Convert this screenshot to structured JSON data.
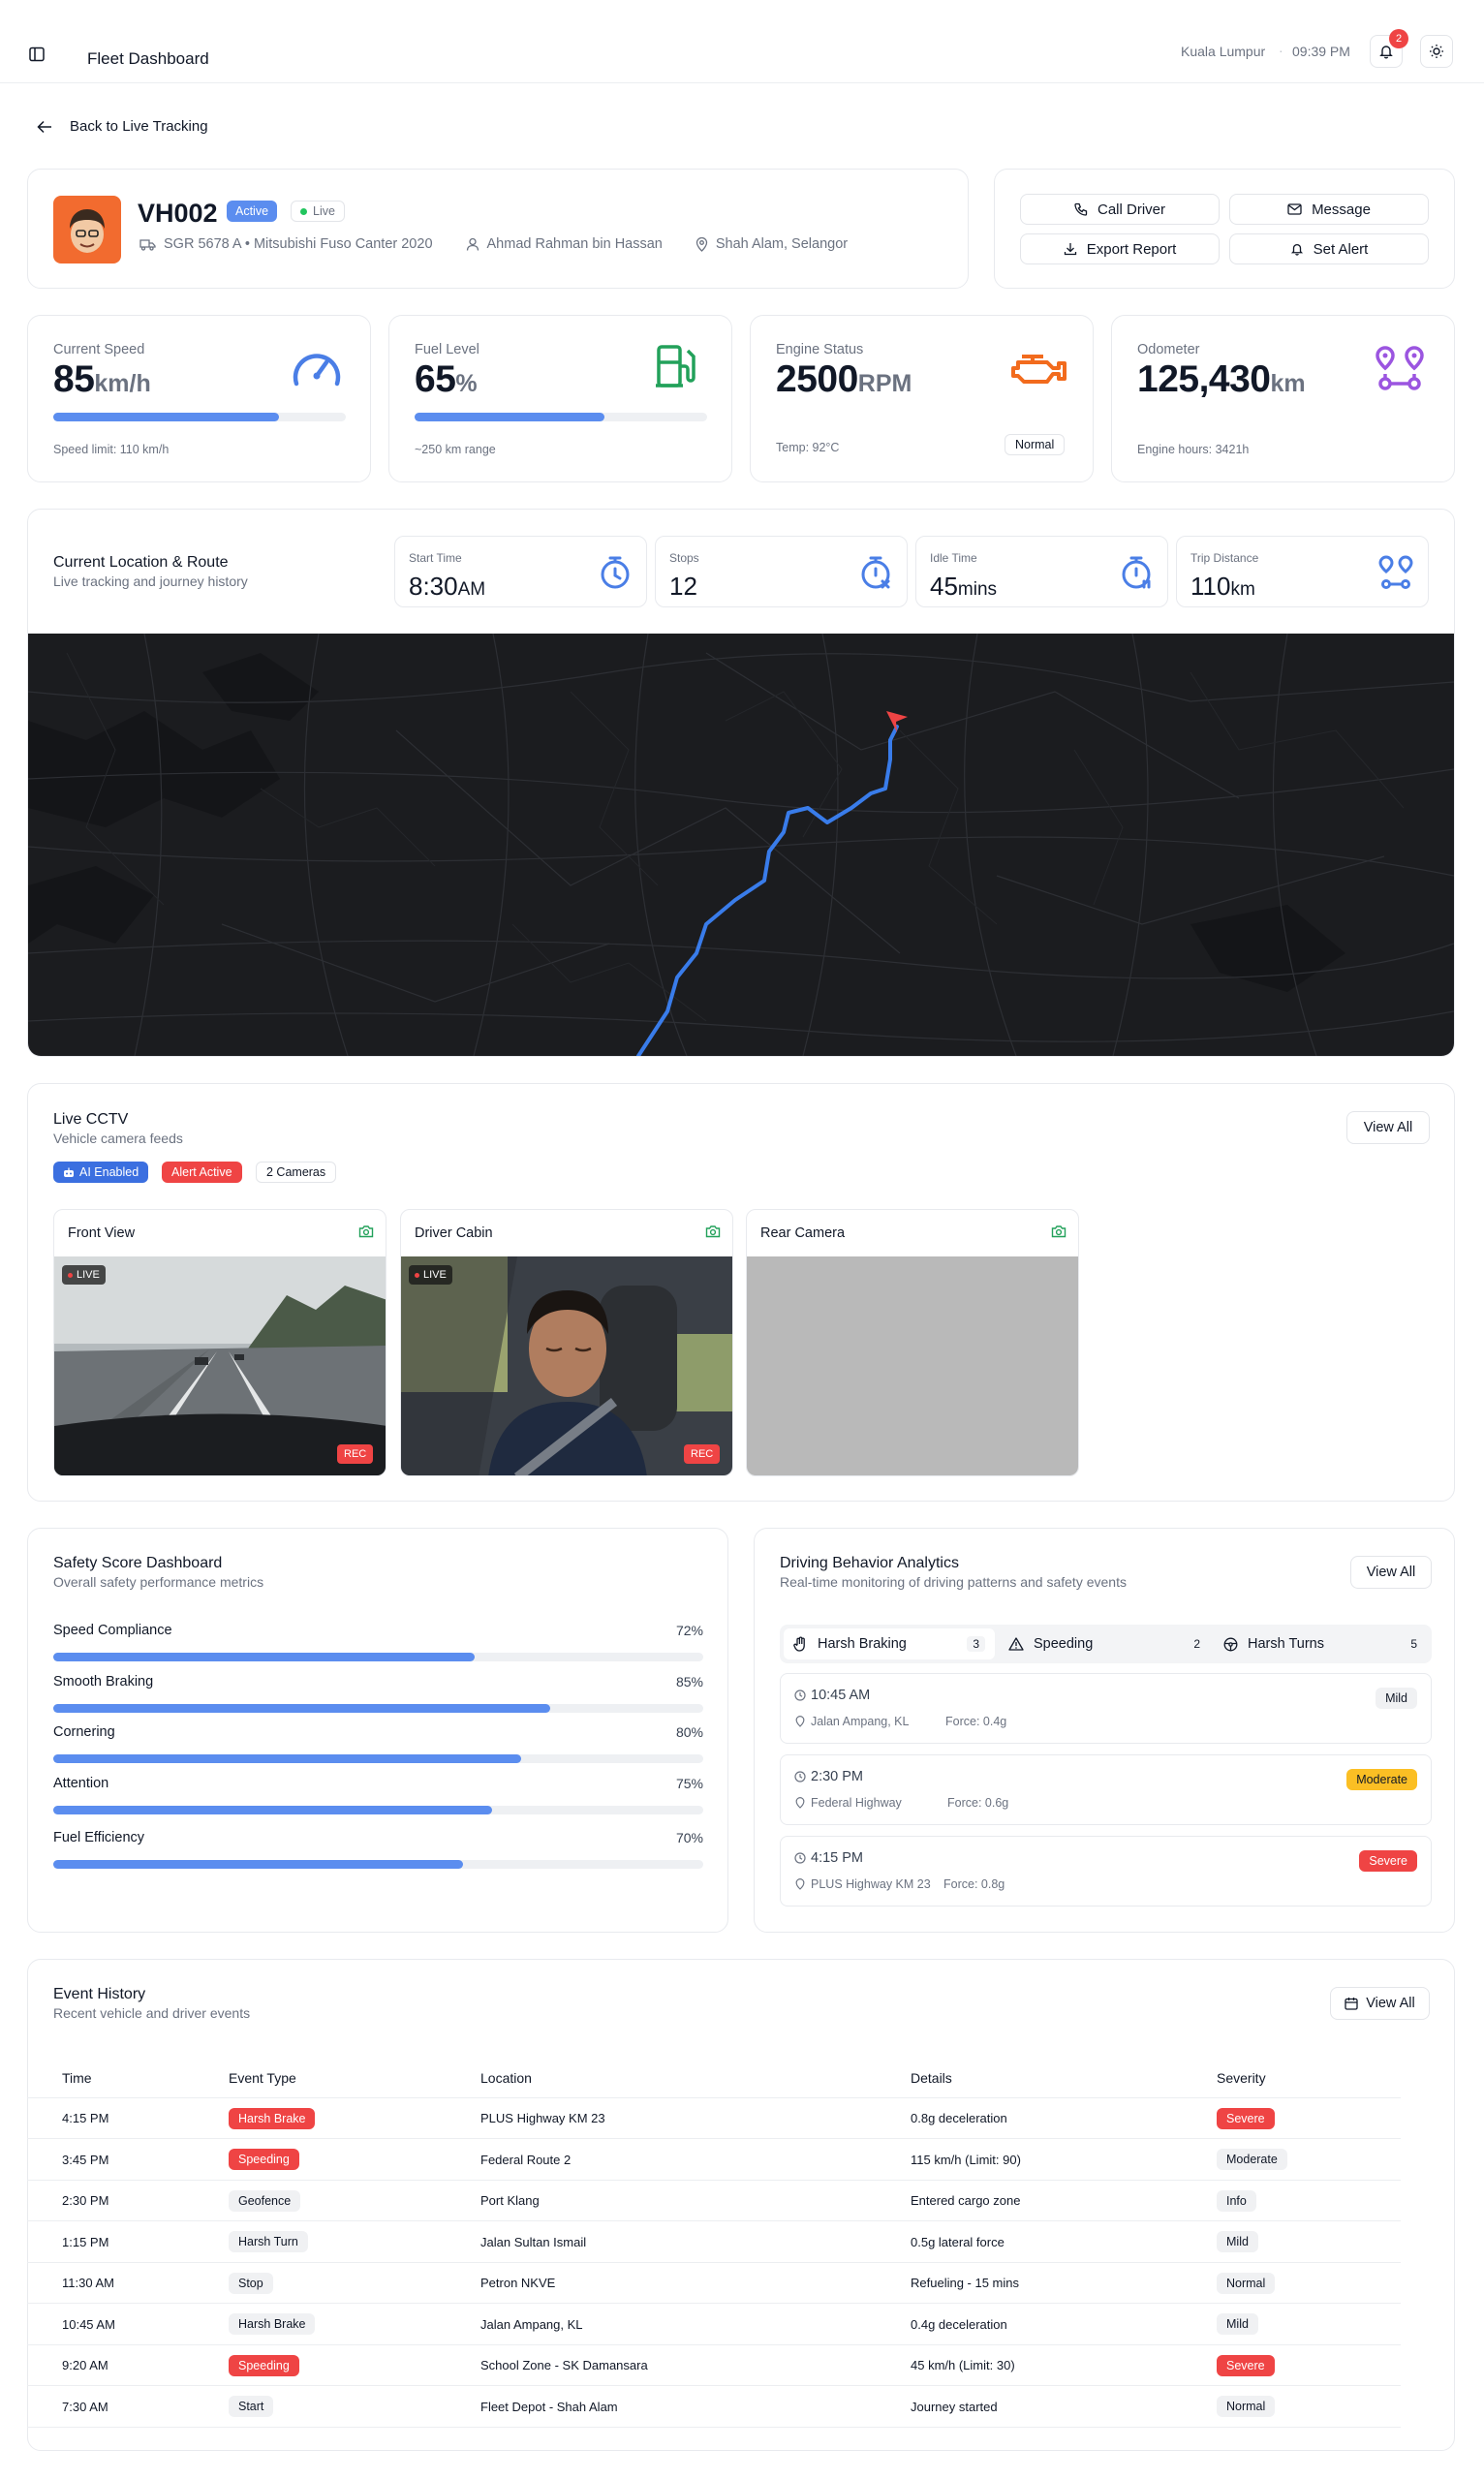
{
  "header": {
    "title": "Fleet Dashboard",
    "location": "Kuala Lumpur",
    "time": "09:39 PM",
    "notif_count": "2"
  },
  "back_link": "Back to Live Tracking",
  "vehicle": {
    "id": "VH002",
    "status": "Active",
    "live": "Live",
    "plate": "SGR 5678 A • Mitsubishi Fuso Canter 2020",
    "driver": "Ahmad Rahman bin Hassan",
    "location": "Shah Alam, Selangor"
  },
  "actions": {
    "call": "Call Driver",
    "message": "Message",
    "export": "Export Report",
    "alert": "Set Alert"
  },
  "stats": {
    "speed": {
      "label": "Current Speed",
      "value": "85",
      "unit": "km/h",
      "note": "Speed limit: 110 km/h",
      "progress": 77
    },
    "fuel": {
      "label": "Fuel Level",
      "value": "65",
      "unit": "%",
      "note": "~250 km range",
      "progress": 65
    },
    "engine": {
      "label": "Engine Status",
      "value": "2500",
      "unit": "RPM",
      "note": "Temp: 92°C",
      "badge": "Normal"
    },
    "odometer": {
      "label": "Odometer",
      "value": "125,430",
      "unit": "km",
      "note": "Engine hours: 3421h"
    }
  },
  "route": {
    "title": "Current Location & Route",
    "subtitle": "Live tracking and journey history",
    "start_label": "Start Time",
    "start_value": "8:30",
    "start_unit": "AM",
    "stops_label": "Stops",
    "stops_value": "12",
    "idle_label": "Idle Time",
    "idle_value": "45",
    "idle_unit": "mins",
    "dist_label": "Trip Distance",
    "dist_value": "110",
    "dist_unit": "km"
  },
  "cctv": {
    "title": "Live CCTV",
    "subtitle": "Vehicle camera feeds",
    "ai": "AI Enabled",
    "alert": "Alert Active",
    "count": "2 Cameras",
    "view_all": "View All",
    "cams": [
      {
        "name": "Front View",
        "live": "LIVE",
        "rec": "REC"
      },
      {
        "name": "Driver Cabin",
        "live": "LIVE",
        "rec": "REC"
      },
      {
        "name": "Rear Camera"
      }
    ]
  },
  "safety": {
    "title": "Safety Score Dashboard",
    "subtitle": "Overall safety performance metrics",
    "items": [
      {
        "label": "Speed Compliance",
        "pct": "72%",
        "value": 72
      },
      {
        "label": "Smooth Braking",
        "pct": "85%",
        "value": 85
      },
      {
        "label": "Cornering",
        "pct": "80%",
        "value": 80
      },
      {
        "label": "Attention",
        "pct": "75%",
        "value": 75
      },
      {
        "label": "Fuel Efficiency",
        "pct": "70%",
        "value": 70
      }
    ]
  },
  "behavior": {
    "title": "Driving Behavior Analytics",
    "subtitle": "Real-time monitoring of driving patterns and safety events",
    "view_all": "View All",
    "tabs": [
      {
        "label": "Harsh Braking",
        "count": "3"
      },
      {
        "label": "Speeding",
        "count": "2"
      },
      {
        "label": "Harsh Turns",
        "count": "5"
      }
    ],
    "events": [
      {
        "time": "10:45 AM",
        "place": "Jalan Ampang, KL",
        "force": "Force: 0.4g",
        "level": "Mild"
      },
      {
        "time": "2:30 PM",
        "place": "Federal Highway",
        "force": "Force: 0.6g",
        "level": "Moderate"
      },
      {
        "time": "4:15 PM",
        "place": "PLUS Highway KM 23",
        "force": "Force: 0.8g",
        "level": "Severe"
      }
    ]
  },
  "history": {
    "title": "Event History",
    "subtitle": "Recent vehicle and driver events",
    "view_all": "View All",
    "columns": [
      "Time",
      "Event Type",
      "Location",
      "Details",
      "Severity"
    ],
    "rows": [
      {
        "time": "4:15 PM",
        "type": "Harsh Brake",
        "loc": "PLUS Highway KM 23",
        "details": "0.8g deceleration",
        "sev": "Severe"
      },
      {
        "time": "3:45 PM",
        "type": "Speeding",
        "loc": "Federal Route 2",
        "details": "115 km/h (Limit: 90)",
        "sev": "Moderate"
      },
      {
        "time": "2:30 PM",
        "type": "Geofence",
        "loc": "Port Klang",
        "details": "Entered cargo zone",
        "sev": "Info"
      },
      {
        "time": "1:15 PM",
        "type": "Harsh Turn",
        "loc": "Jalan Sultan Ismail",
        "details": "0.5g lateral force",
        "sev": "Mild"
      },
      {
        "time": "11:30 AM",
        "type": "Stop",
        "loc": "Petron NKVE",
        "details": "Refueling - 15 mins",
        "sev": "Normal"
      },
      {
        "time": "10:45 AM",
        "type": "Harsh Brake",
        "loc": "Jalan Ampang, KL",
        "details": "0.4g deceleration",
        "sev": "Mild"
      },
      {
        "time": "9:20 AM",
        "type": "Speeding",
        "loc": "School Zone - SK Damansara",
        "details": "45 km/h (Limit: 30)",
        "sev": "Severe"
      },
      {
        "time": "7:30 AM",
        "type": "Start",
        "loc": "Fleet Depot - Shah Alam",
        "details": "Journey started",
        "sev": "Normal"
      }
    ]
  }
}
